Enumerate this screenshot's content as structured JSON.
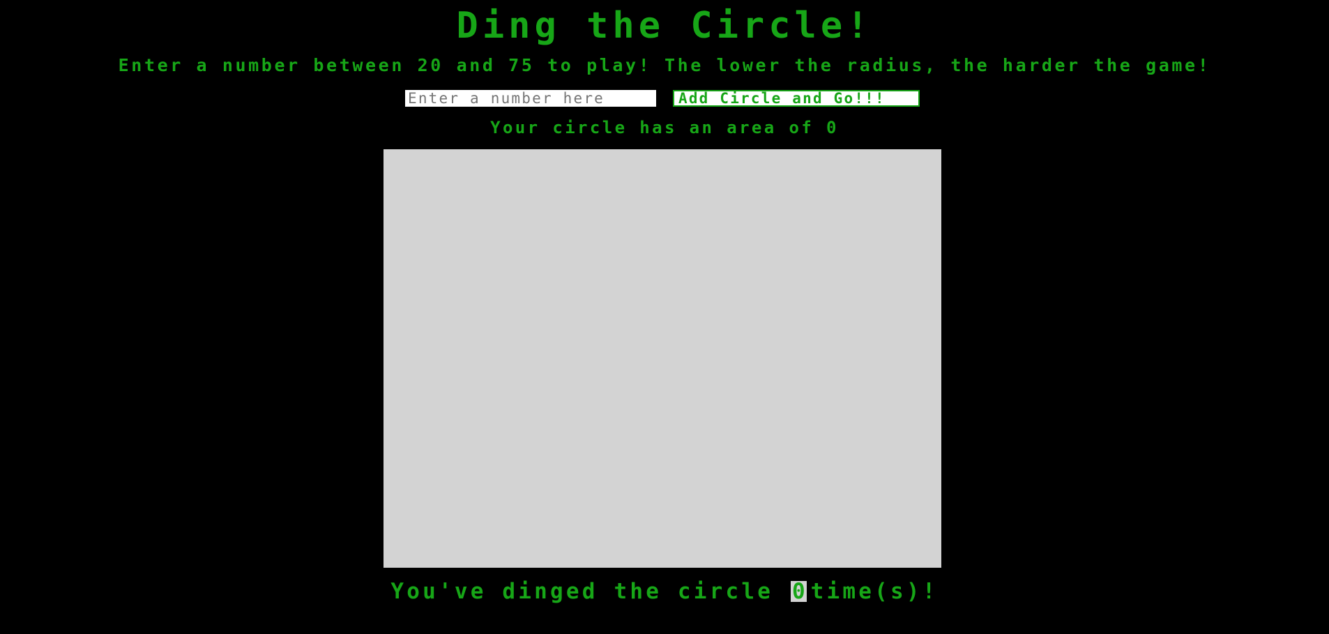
{
  "header": {
    "title": "Ding the Circle!",
    "instructions": "Enter a number between 20 and 75 to play! The lower the radius, the harder the game!"
  },
  "controls": {
    "input_value": "",
    "input_placeholder": "Enter a number here",
    "go_button_label": "Add Circle and Go!!!"
  },
  "status": {
    "area_prefix": "Your circle has an area of",
    "area_value": "0"
  },
  "score": {
    "prefix": "You've dinged the circle",
    "count": "0",
    "suffix": "time(s)!"
  },
  "colors": {
    "background": "#000000",
    "accent": "#17a617",
    "board": "#d3d3d3",
    "input_background": "#ffffff"
  }
}
